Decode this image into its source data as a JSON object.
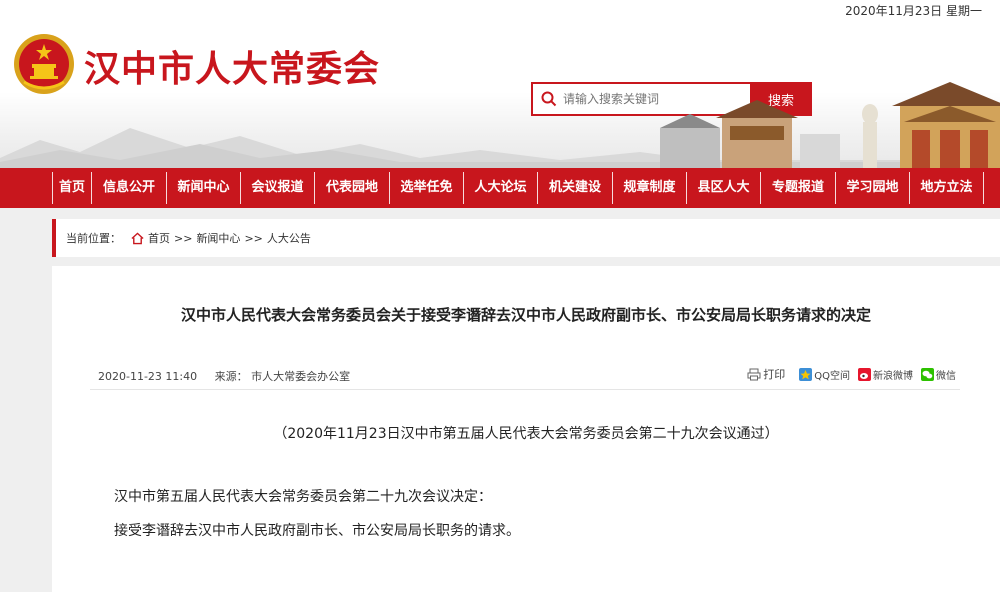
{
  "header": {
    "date": "2020年11月23日 星期一",
    "site_title": "汉中市人大常委会",
    "search_placeholder": "请输入搜索关键词",
    "search_button": "搜索"
  },
  "nav": {
    "items": [
      "首页",
      "信息公开",
      "新闻中心",
      "会议报道",
      "代表园地",
      "选举任免",
      "人大论坛",
      "机关建设",
      "规章制度",
      "县区人大",
      "专题报道",
      "学习园地",
      "地方立法"
    ]
  },
  "breadcrumb": {
    "label": "当前位置：",
    "home": "首页",
    "sep": ">>",
    "level1": "新闻中心",
    "level2": "人大公告"
  },
  "article": {
    "title": "汉中市人民代表大会常务委员会关于接受李谮辞去汉中市人民政府副市长、市公安局局长职务请求的决定",
    "datetime": "2020-11-23 11:40",
    "source": "来源： 市人大常委会办公室",
    "print": "打印",
    "share_qq": "QQ空间",
    "share_weibo": "新浪微博",
    "share_wechat": "微信",
    "subtitle": "（2020年11月23日汉中市第五届人民代表大会常务委员会第二十九次会议通过）",
    "para1": "汉中市第五届人民代表大会常务委员会第二十九次会议决定：",
    "para2": "接受李谮辞去汉中市人民政府副市长、市公安局局长职务的请求。"
  },
  "colors": {
    "accent": "#c8161d"
  }
}
